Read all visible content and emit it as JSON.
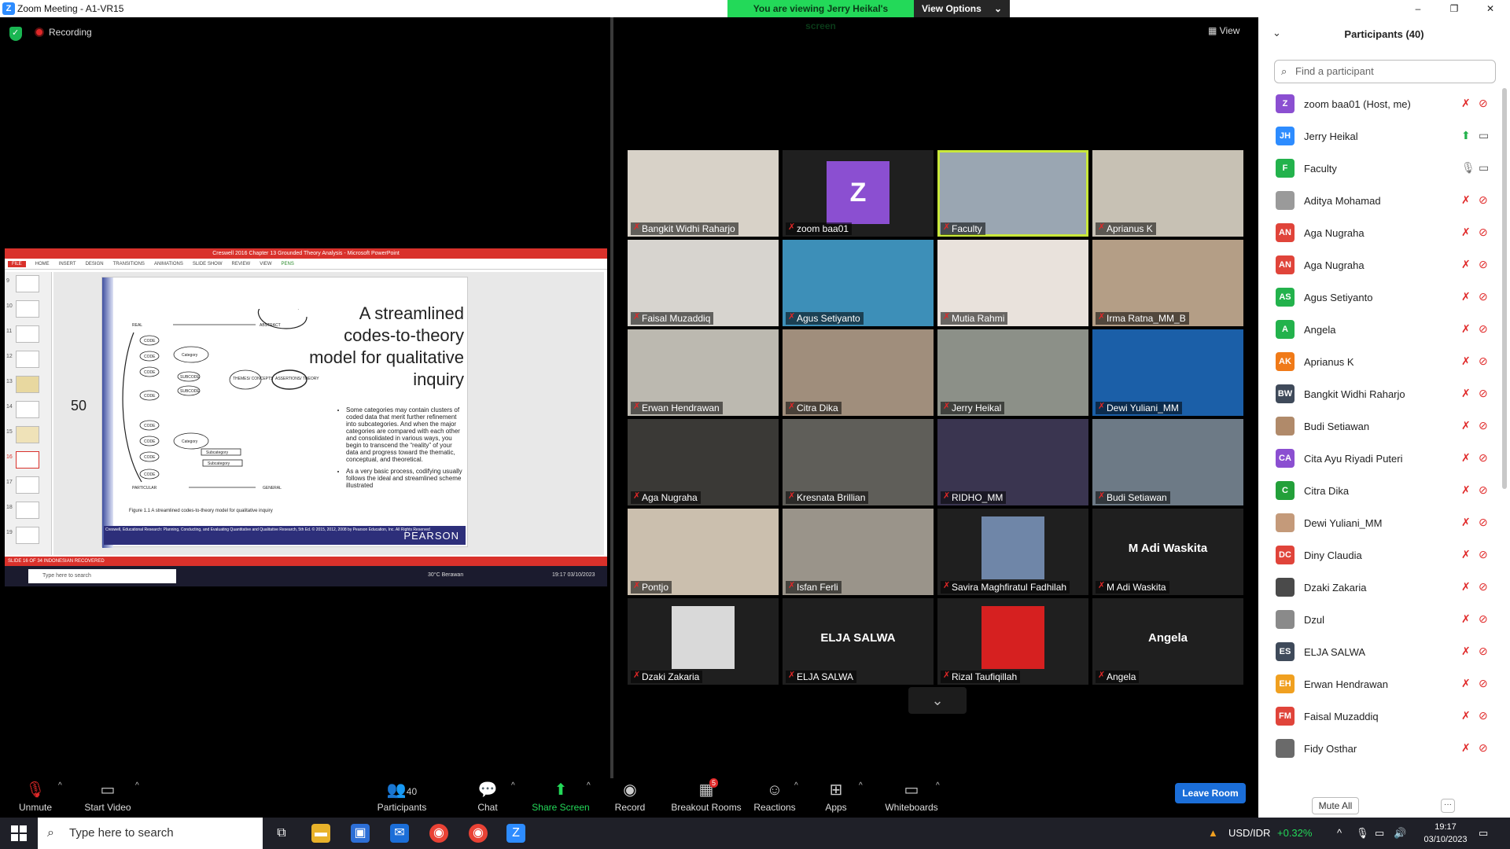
{
  "window": {
    "title": "Zoom Meeting - A1-VR15",
    "minimize": "–",
    "maximize": "❐",
    "close": "✕"
  },
  "banner": {
    "viewing": "You are viewing Jerry Heikal's screen",
    "options": "View Options"
  },
  "status": {
    "recording": "Recording"
  },
  "view_button": "View",
  "shared": {
    "ppt_title": "Creswell 2016 Chapter 13 Grounded Theory Analysis - Microsoft PowerPoint",
    "ribbon": [
      "FILE",
      "HOME",
      "INSERT",
      "DESIGN",
      "TRANSITIONS",
      "ANIMATIONS",
      "SLIDE SHOW",
      "REVIEW",
      "VIEW",
      "PENS"
    ],
    "thumbs": [
      "9",
      "10",
      "11",
      "12",
      "13",
      "14",
      "15",
      "16",
      "17",
      "18",
      "19"
    ],
    "slide_title": "A streamlined codes-to-theory model for qualitative inquiry",
    "bullets": [
      "Some categories may contain clusters of coded data that merit further refinement into subcategories. And when the major categories are compared with each other and consolidated in various ways, you begin to transcend the “reality” of your data and progress toward the thematic, conceptual, and theoretical.",
      "As a very basic process, codifying usually follows the ideal and streamlined scheme illustrated"
    ],
    "figure": "Figure 1.1   A streamlined codes-to-theory model for qualitative inquiry",
    "footer": "Creswell, Educational Research: Planning, Conducting, and Evaluating Quantitative and Qualitative Research, 5th Ed. © 2015, 2012, 2008 by Pearson Education, Inc. All Rights Reserved",
    "publisher": "PEARSON",
    "statusbar": "SLIDE 16 OF 34    INDONESIAN    RECOVERED",
    "taskbar_search": "Type here to search",
    "weather": "30°C  Berawan",
    "clock": "19:17 03/10/2023",
    "handwritten_number": "50",
    "diagram": {
      "real": "REAL",
      "abstract": "ABSTRACT",
      "particular": "PARTICULAR",
      "general": "GENERAL",
      "code": "CODE",
      "category": "Category",
      "subcode": "SUBCODE",
      "subcategory": "Subcategory",
      "themes": "THEMES/ CONCEPTS",
      "assertions": "ASSERTIONS/ THEORY"
    }
  },
  "tiles": [
    {
      "name": "Bangkit Widhi Raharjo",
      "bg": "#d8d2c8"
    },
    {
      "name": "zoom baa01",
      "avatar": "Z",
      "bg": "#1f1f1f"
    },
    {
      "name": "Faculty",
      "bg": "#9aa6b2",
      "active": true
    },
    {
      "name": "Aprianus K",
      "bg": "#c7c1b4"
    },
    {
      "name": "Faisal Muzaddiq",
      "bg": "#d7d4cf"
    },
    {
      "name": "Agus Setiyanto",
      "bg": "#3d8fb8"
    },
    {
      "name": "Mutia Rahmi",
      "bg": "#e9e2dc"
    },
    {
      "name": "Irma Ratna_MM_B",
      "bg": "#b49e86"
    },
    {
      "name": "Erwan Hendrawan",
      "bg": "#bcb9b0"
    },
    {
      "name": "Citra Dika",
      "bg": "#a08e7c"
    },
    {
      "name": "Jerry Heikal",
      "bg": "#8c9088"
    },
    {
      "name": "Dewi Yuliani_MM",
      "bg": "#1b5fa8"
    },
    {
      "name": "Aga Nugraha",
      "bg": "#3a3936"
    },
    {
      "name": "Kresnata Brillian",
      "bg": "#5f5e59"
    },
    {
      "name": "RIDHO_MM",
      "bg": "#3a3550"
    },
    {
      "name": "Budi Setiawan",
      "bg": "#6d7a86"
    },
    {
      "name": "Pontjo",
      "bg": "#cbbfae"
    },
    {
      "name": "Isfan Ferli",
      "bg": "#9a948a"
    },
    {
      "name": "Savira Maghfiratul Fadhilah",
      "bg": "#1f1f1f",
      "photo": "#6f86a8"
    },
    {
      "name": "M Adi Waskita",
      "bg": "#1f1f1f",
      "bigname": "M Adi Waskita"
    },
    {
      "name": "Dzaki Zakaria",
      "bg": "#1f1f1f",
      "photo": "#d9d9d9"
    },
    {
      "name": "ELJA SALWA",
      "bg": "#1f1f1f",
      "bigname": "ELJA SALWA"
    },
    {
      "name": "Rizal Taufiqillah",
      "bg": "#1f1f1f",
      "photo": "#d62020"
    },
    {
      "name": "Angela",
      "bg": "#1f1f1f",
      "bigname": "Angela"
    }
  ],
  "toolbar": {
    "unmute": "Unmute",
    "start_video": "Start Video",
    "participants": "Participants",
    "participants_count": "40",
    "chat": "Chat",
    "share": "Share Screen",
    "record": "Record",
    "breakout": "Breakout Rooms",
    "breakout_badge": "5",
    "reactions": "Reactions",
    "apps": "Apps",
    "whiteboards": "Whiteboards",
    "leave": "Leave Room"
  },
  "panel": {
    "title": "Participants (40)",
    "search_placeholder": "Find a participant",
    "mute_all": "Mute All",
    "more": "···",
    "participants": [
      {
        "initials": "Z",
        "name": "zoom baa01 (Host, me)",
        "color": "#8b4fd1"
      },
      {
        "initials": "JH",
        "name": "Jerry Heikal",
        "color": "#2d8cff",
        "sharing": true
      },
      {
        "initials": "F",
        "name": "Faculty",
        "color": "#23b24c",
        "mic_on": true
      },
      {
        "initials": "",
        "name": "Aditya Mohamad",
        "color": "#9a9a9a"
      },
      {
        "initials": "AN",
        "name": "Aga Nugraha",
        "color": "#e0443a"
      },
      {
        "initials": "AN",
        "name": "Aga Nugraha",
        "color": "#e0443a"
      },
      {
        "initials": "AS",
        "name": "Agus Setiyanto",
        "color": "#23b24c"
      },
      {
        "initials": "A",
        "name": "Angela",
        "color": "#23b24c"
      },
      {
        "initials": "AK",
        "name": "Aprianus K",
        "color": "#f07a18"
      },
      {
        "initials": "BW",
        "name": "Bangkit Widhi Raharjo",
        "color": "#3f4a5a"
      },
      {
        "initials": "",
        "name": "Budi Setiawan",
        "color": "#b08a6a"
      },
      {
        "initials": "CA",
        "name": "Cita Ayu Riyadi Puteri",
        "color": "#8b4fd1"
      },
      {
        "initials": "C",
        "name": "Citra Dika",
        "color": "#23a03a"
      },
      {
        "initials": "",
        "name": "Dewi Yuliani_MM",
        "color": "#c49a7a"
      },
      {
        "initials": "DC",
        "name": "Diny Claudia",
        "color": "#e0443a"
      },
      {
        "initials": "",
        "name": "Dzaki Zakaria",
        "color": "#4a4a4a"
      },
      {
        "initials": "",
        "name": "Dzul",
        "color": "#8a8a8a"
      },
      {
        "initials": "ES",
        "name": "ELJA SALWA",
        "color": "#3f4a5a"
      },
      {
        "initials": "EH",
        "name": "Erwan Hendrawan",
        "color": "#f0a020"
      },
      {
        "initials": "FM",
        "name": "Faisal Muzaddiq",
        "color": "#e0443a"
      },
      {
        "initials": "",
        "name": "Fidy Osthar",
        "color": "#6a6a6a"
      }
    ]
  },
  "taskbar": {
    "search": "Type here to search",
    "currency": "USD/IDR",
    "change": "+0.32%",
    "time": "19:17",
    "date": "03/10/2023"
  }
}
